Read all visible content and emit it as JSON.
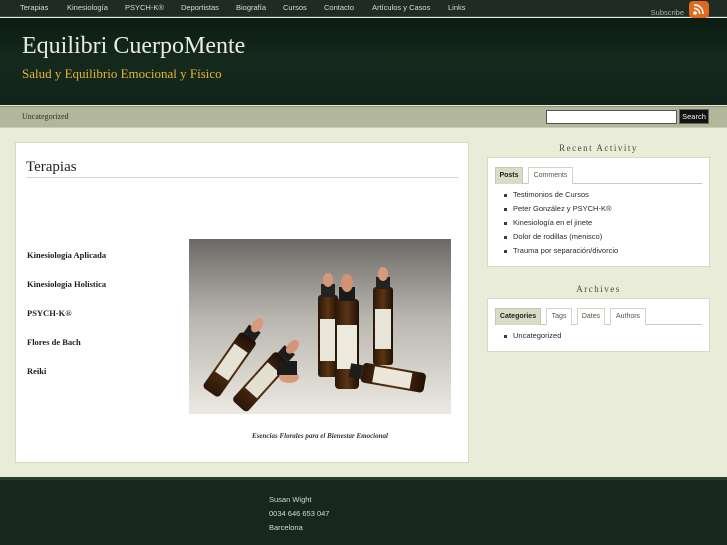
{
  "nav": {
    "items": [
      "Terapias",
      "Kinesiología",
      "PSYCH-K®",
      "Deportistas",
      "Biografía",
      "Cursos",
      "Contacto",
      "Artículos y Casos",
      "Links"
    ],
    "subscribe": "Subscribe",
    "rss_icon": "rss-feed-icon"
  },
  "header": {
    "title": "Equilibri CuerpoMente",
    "tagline": "Salud y Equilibrio Emocional y Físico"
  },
  "catbar": {
    "category": "Uncategorized",
    "search_value": "",
    "search_button": "Search"
  },
  "main": {
    "title": "Terapias",
    "links": [
      "Kinesiología Aplicada",
      "Kinesiología Holística",
      "PSYCH-K®",
      "Flores de Bach",
      "Reiki"
    ],
    "caption": "Esencias Florales para el Bienestar Emocional"
  },
  "sidebar": {
    "recent": {
      "heading": "Recent Activity",
      "tabs": [
        "Posts",
        "Comments"
      ],
      "items": [
        "Testimonios de Cursos",
        "Peter González y PSYCH-K®",
        "Kinesiología en el jinete",
        "Dolor de rodillas (menisco)",
        "Trauma por separación/divorcio"
      ]
    },
    "archives": {
      "heading": "Archives",
      "tabs": [
        "Categories",
        "Tags",
        "Dates",
        "Authors"
      ],
      "items": [
        "Uncategorized"
      ]
    }
  },
  "footer": {
    "lines": [
      "Susan Wight",
      "0034 646 653 047",
      "Barcelona"
    ]
  },
  "colors": {
    "header_bg": "#10241a",
    "tagline": "#e6b632",
    "page_bg": "#e9ecd8",
    "catbar_bg": "#b2b79b",
    "rss": "#e06a1c"
  }
}
